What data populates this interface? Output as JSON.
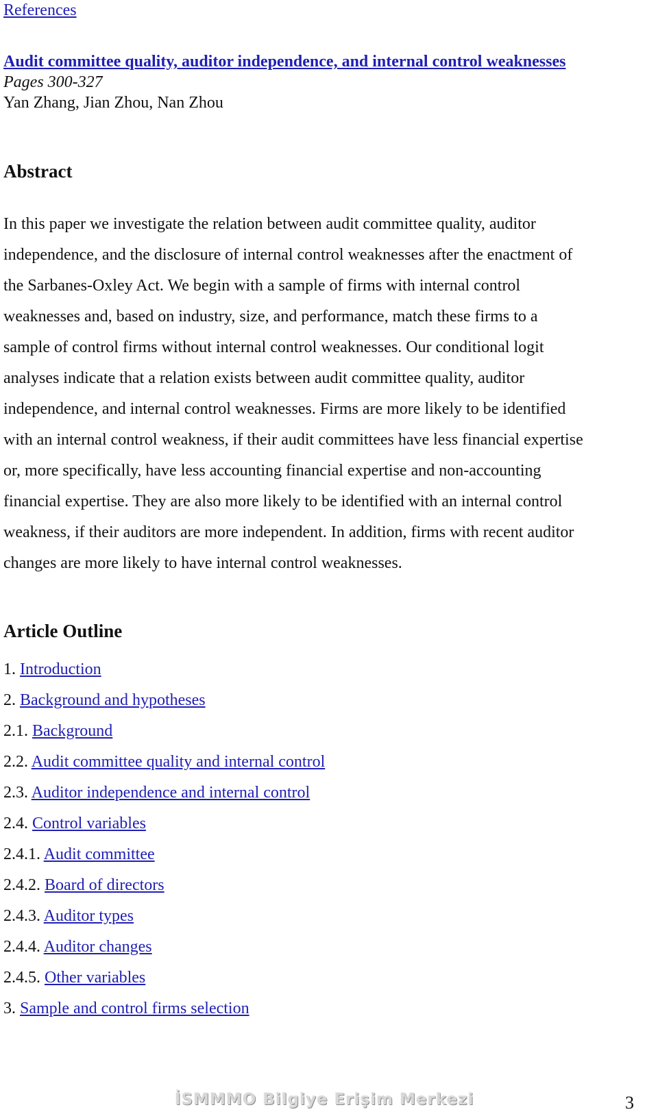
{
  "header": {
    "references_link": "References"
  },
  "article": {
    "title": "Audit committee quality, auditor independence, and internal control weaknesses",
    "pages": "Pages 300-327",
    "authors": "Yan Zhang, Jian Zhou, Nan Zhou"
  },
  "abstract": {
    "heading": "Abstract",
    "lines": [
      "In this paper we investigate the relation between audit committee quality, auditor",
      "independence, and the disclosure of internal control weaknesses after the enactment of",
      "the Sarbanes-Oxley Act. We begin with a sample of firms with internal control",
      "weaknesses and, based on industry, size, and performance, match these firms to a",
      "sample of control firms without internal control weaknesses. Our conditional logit",
      "analyses indicate that a relation exists between audit committee quality, auditor",
      "independence, and internal control weaknesses. Firms are more likely to be identified",
      "with an internal control weakness, if their audit committees have less financial expertise",
      "or, more specifically, have less accounting financial expertise and non-accounting",
      "financial expertise. They are also more likely to be identified with an internal control",
      "weakness, if their auditors are more independent. In addition, firms with recent auditor",
      "changes are more likely to have internal control weaknesses."
    ]
  },
  "outline": {
    "heading": "Article Outline",
    "items": [
      {
        "number": "1. ",
        "label": "Introduction"
      },
      {
        "number": "2. ",
        "label": "Background and hypotheses"
      },
      {
        "number": "2.1. ",
        "label": "Background"
      },
      {
        "number": "2.2. ",
        "label": "Audit committee quality and internal control"
      },
      {
        "number": "2.3. ",
        "label": "Auditor independence and internal control"
      },
      {
        "number": "2.4. ",
        "label": "Control variables"
      },
      {
        "number": "2.4.1. ",
        "label": "Audit committee"
      },
      {
        "number": "2.4.2. ",
        "label": "Board of directors"
      },
      {
        "number": "2.4.3. ",
        "label": "Auditor types"
      },
      {
        "number": "2.4.4. ",
        "label": "Auditor changes"
      },
      {
        "number": "2.4.5. ",
        "label": "Other variables"
      },
      {
        "number": "3. ",
        "label": "Sample and control firms selection"
      }
    ]
  },
  "footer": {
    "watermark": "İSMMMO Bilgiye Erişim Merkezi",
    "page_number": "3"
  },
  "colors": {
    "link": "#1f1fb4",
    "text": "#111111",
    "watermark": "#d8d8d8"
  }
}
